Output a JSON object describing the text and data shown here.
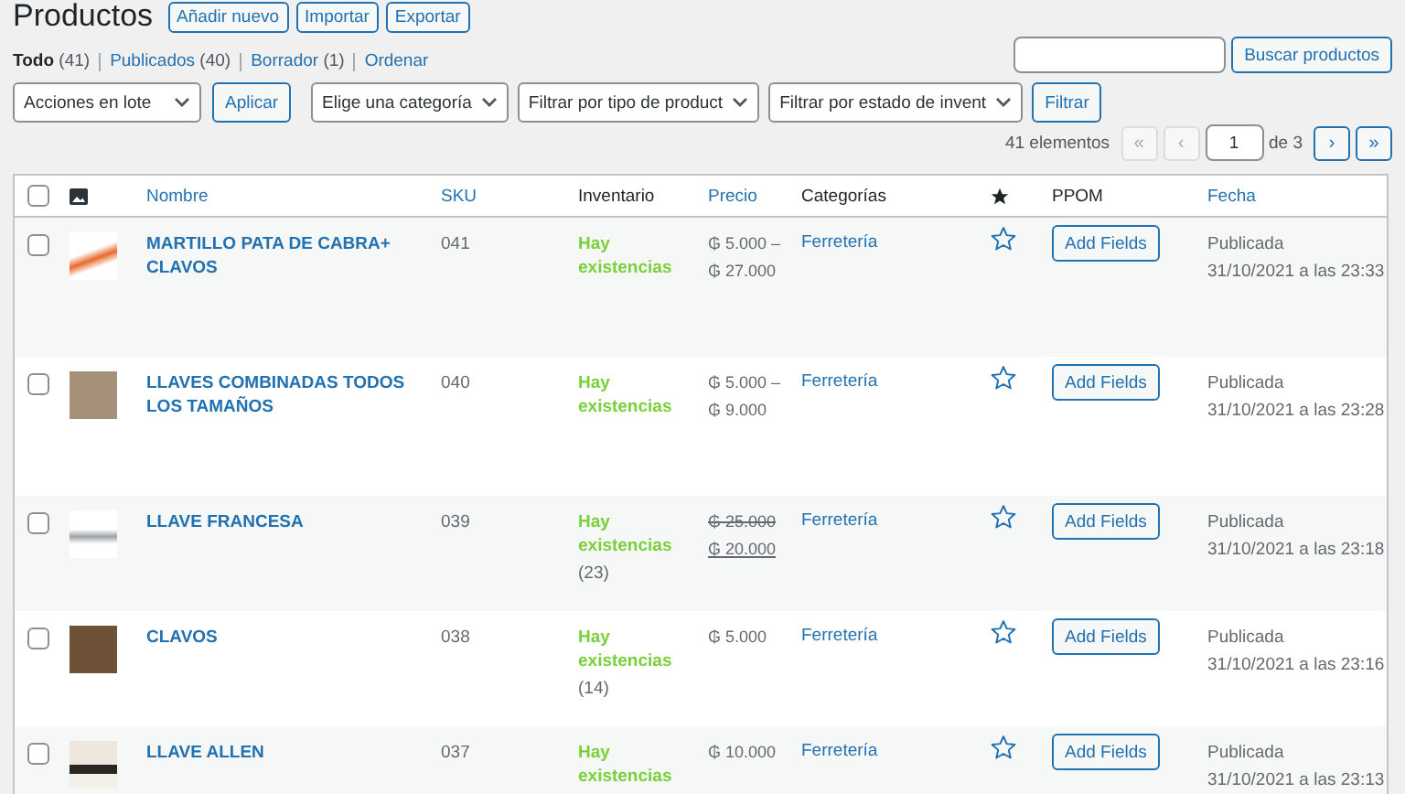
{
  "header": {
    "title": "Productos",
    "buttons": [
      "Añadir nuevo",
      "Importar",
      "Exportar"
    ]
  },
  "views": [
    {
      "label": "Todo",
      "count": "(41)",
      "selected": true
    },
    {
      "label": "Publicados",
      "count": "(40)",
      "selected": false
    },
    {
      "label": "Borrador",
      "count": "(1)",
      "selected": false
    },
    {
      "label": "Ordenar",
      "selected": false
    }
  ],
  "search": {
    "button": "Buscar productos"
  },
  "filters": {
    "bulk_action": "Acciones en lote",
    "apply": "Aplicar",
    "selects": [
      "Elige una categoría",
      "Filtrar por tipo de product",
      "Filtrar por estado de invent"
    ],
    "filter": "Filtrar"
  },
  "pagination": {
    "count": "41 elementos",
    "first": {
      "label": "«",
      "disabled": true
    },
    "prev": {
      "label": "‹",
      "disabled": true
    },
    "current": "1",
    "total": "de 3",
    "next": {
      "label": "›",
      "disabled": false
    },
    "last": {
      "label": "»",
      "disabled": false
    }
  },
  "table": {
    "select_all": {
      "checked": false
    },
    "columns": [
      {
        "kind": "image"
      },
      {
        "kind": "text",
        "label": "Nombre",
        "sortable": true
      },
      {
        "kind": "text",
        "label": "SKU",
        "sortable": true
      },
      {
        "kind": "text",
        "label": "Inventario",
        "sortable": false
      },
      {
        "kind": "text",
        "label": "Precio",
        "sortable": true
      },
      {
        "kind": "text",
        "label": "Categorías",
        "sortable": false
      },
      {
        "kind": "star"
      },
      {
        "kind": "text",
        "label": "PPOM",
        "sortable": false
      },
      {
        "kind": "text",
        "label": "Fecha",
        "sortable": true
      }
    ],
    "rows": [
      {
        "checked": false,
        "name": "MARTILLO PATA DE CABRA+ CLAVOS",
        "sku": "041",
        "stock": "Hay existencias",
        "price": [
          {
            "text": "₲ 5.000 –",
            "kind": "regular"
          },
          {
            "text": "₲ 27.000",
            "kind": "regular"
          }
        ],
        "category": "Ferretería",
        "featured": false,
        "ppom": "Add Fields",
        "status": "Publicada",
        "date": "31/10/2021 a las 23:33"
      },
      {
        "checked": false,
        "name": "LLAVES COMBINADAS TODOS LOS TAMAÑOS",
        "sku": "040",
        "stock": "Hay existencias",
        "price": [
          {
            "text": "₲ 5.000 –",
            "kind": "regular"
          },
          {
            "text": "₲ 9.000",
            "kind": "regular"
          }
        ],
        "category": "Ferretería",
        "featured": false,
        "ppom": "Add Fields",
        "status": "Publicada",
        "date": "31/10/2021 a las 23:28"
      },
      {
        "checked": false,
        "name": "LLAVE FRANCESA",
        "sku": "039",
        "stock": "Hay existencias",
        "stock_count": "(23)",
        "price": [
          {
            "text": "₲ 25.000",
            "kind": "old"
          },
          {
            "text": "₲ 20.000",
            "kind": "sale"
          }
        ],
        "category": "Ferretería",
        "featured": false,
        "ppom": "Add Fields",
        "status": "Publicada",
        "date": "31/10/2021 a las 23:18"
      },
      {
        "checked": false,
        "name": "CLAVOS",
        "sku": "038",
        "stock": "Hay existencias",
        "stock_count": "(14)",
        "price": [
          {
            "text": "₲ 5.000",
            "kind": "regular"
          }
        ],
        "category": "Ferretería",
        "featured": false,
        "ppom": "Add Fields",
        "status": "Publicada",
        "date": "31/10/2021 a las 23:16"
      },
      {
        "checked": false,
        "name": "LLAVE ALLEN",
        "sku": "037",
        "stock": "Hay existencias",
        "price": [
          {
            "text": "₲ 10.000",
            "kind": "regular"
          }
        ],
        "category": "Ferretería",
        "featured": false,
        "ppom": "Add Fields",
        "status": "Publicada",
        "date": "31/10/2021 a las 23:13"
      }
    ]
  }
}
